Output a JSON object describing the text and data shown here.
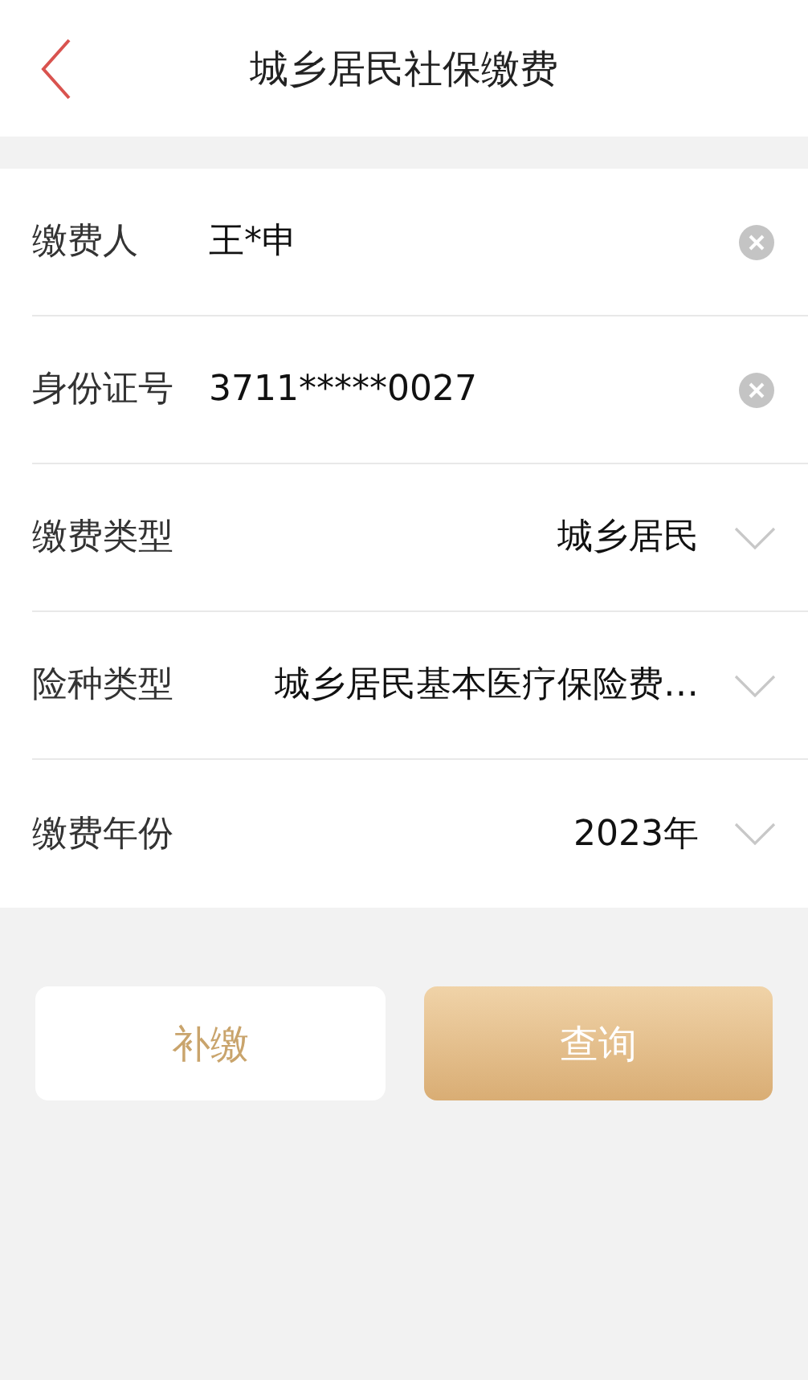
{
  "header": {
    "title": "城乡居民社保缴费"
  },
  "fields": [
    {
      "kind": "input",
      "label": "缴费人",
      "value": "王*申"
    },
    {
      "kind": "input",
      "label": "身份证号",
      "value": "3711*****0027"
    },
    {
      "kind": "select",
      "label": "缴费类型",
      "value": "城乡居民"
    },
    {
      "kind": "select",
      "label": "险种类型",
      "value": "城乡居民基本医疗保险费…"
    },
    {
      "kind": "select",
      "label": "缴费年份",
      "value": "2023年"
    }
  ],
  "buttons": [
    {
      "kind": "secondary",
      "label": "补缴"
    },
    {
      "kind": "primary",
      "label": "查询"
    }
  ]
}
